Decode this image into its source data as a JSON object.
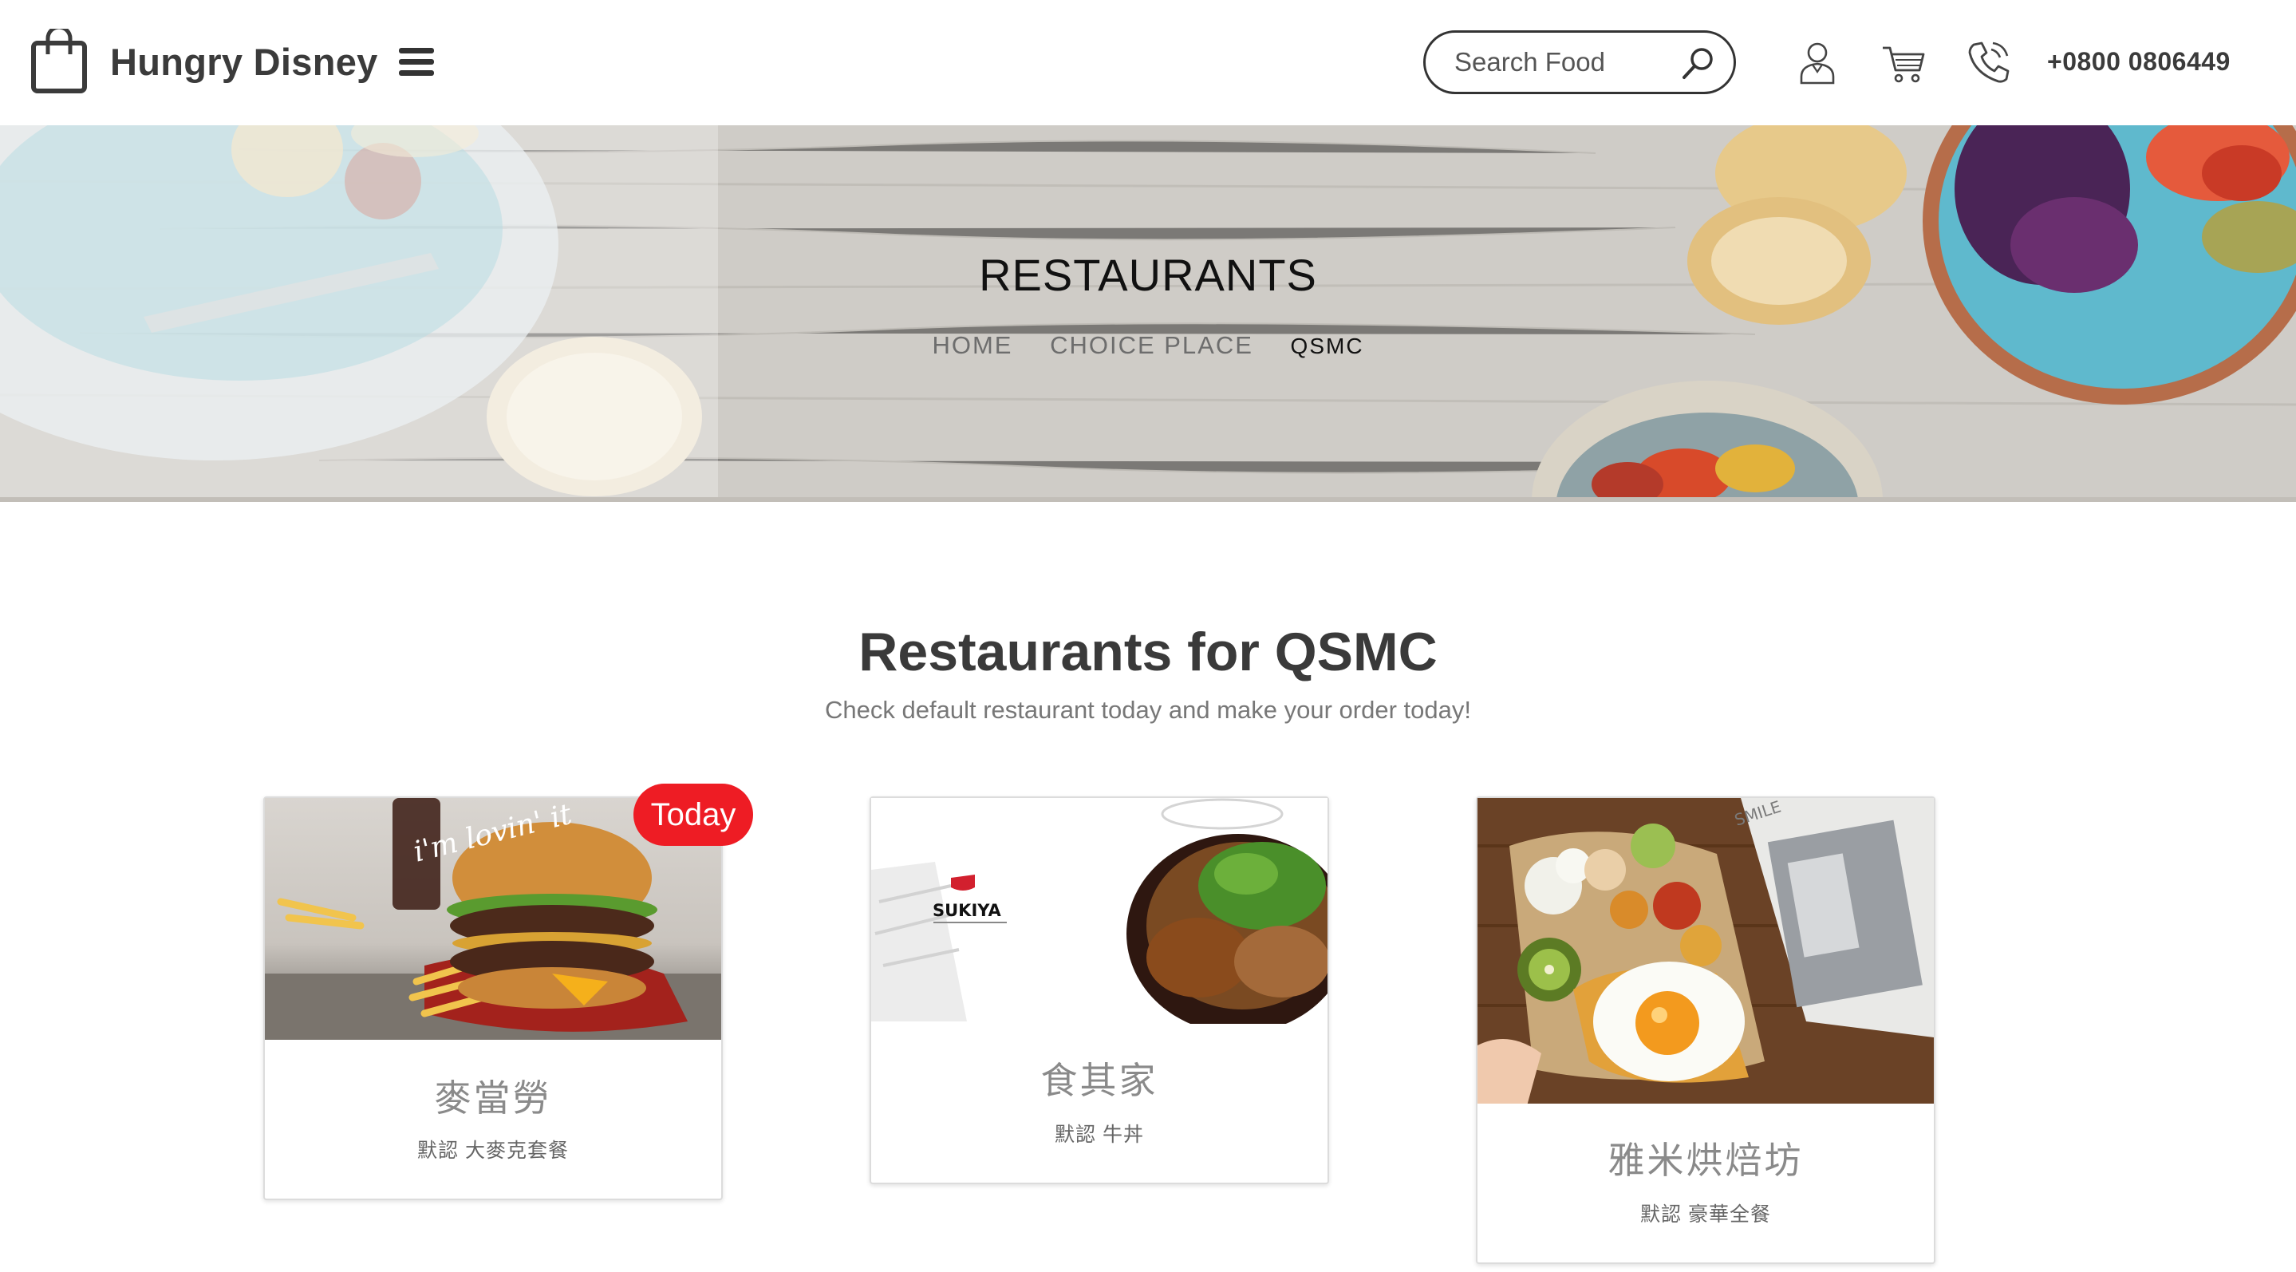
{
  "header": {
    "brand": "Hungry Disney",
    "search_placeholder": "Search Food",
    "phone": "+0800 0806449",
    "icons": [
      "shopping-bag-icon",
      "menu-icon",
      "search-icon",
      "user-icon",
      "cart-icon",
      "phone-icon"
    ]
  },
  "hero": {
    "title": "RESTAURANTS",
    "breadcrumb": [
      "HOME",
      "CHOICE PLACE",
      "QSMC"
    ]
  },
  "section": {
    "title": "Restaurants for QSMC",
    "subtitle": "Check default restaurant today and make your order today!"
  },
  "restaurants": [
    {
      "name": "麥當勞",
      "meta": "默認 大麥克套餐",
      "badge": "Today",
      "ad_slogan": "i'm lovin' it"
    },
    {
      "name": "食其家",
      "meta": "默認 牛丼",
      "brand_logo_text": "SUKIYA"
    },
    {
      "name": "雅米烘焙坊",
      "meta": "默認 豪華全餐",
      "magazine_text": "SMILE"
    }
  ],
  "colors": {
    "accent": "#ee1c24",
    "text": "#3a3a3a",
    "muted": "#777777"
  }
}
